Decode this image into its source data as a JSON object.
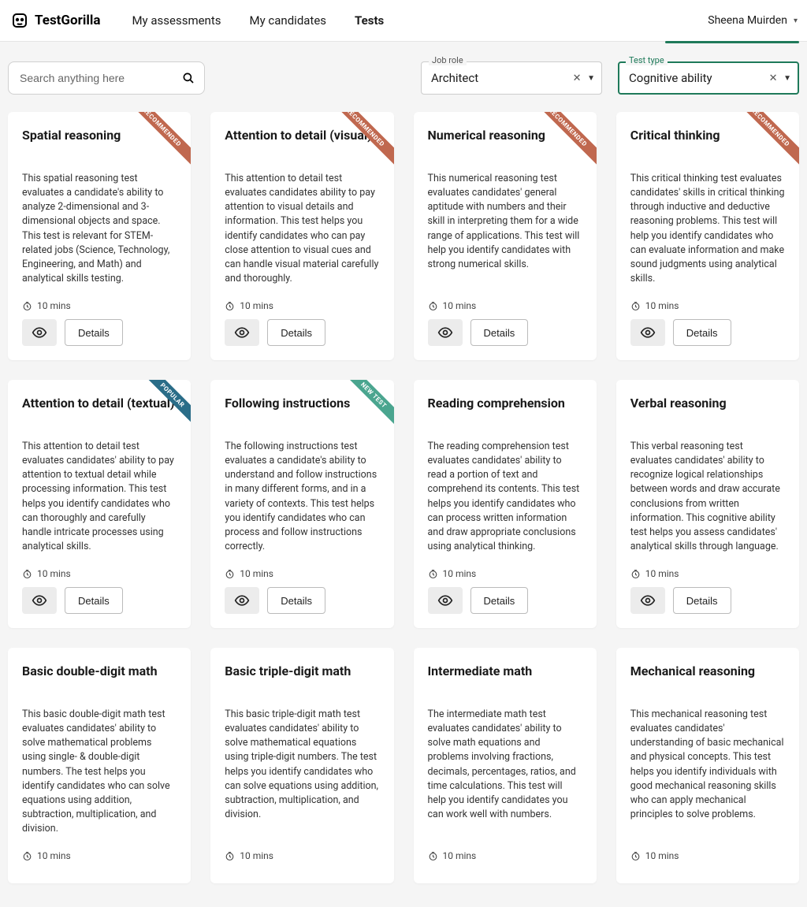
{
  "brand": "TestGorilla",
  "nav": {
    "assessments": "My assessments",
    "candidates": "My candidates",
    "tests": "Tests"
  },
  "user": {
    "name": "Sheena Muirden"
  },
  "search": {
    "placeholder": "Search anything here"
  },
  "filters": {
    "jobrole": {
      "label": "Job role",
      "value": "Architect"
    },
    "testtype": {
      "label": "Test type",
      "value": "Cognitive ability"
    }
  },
  "ribbons": {
    "recommended": "RECOMMENDED",
    "popular": "POPULAR",
    "newtest": "NEW TEST"
  },
  "labels": {
    "details": "Details",
    "duration": "10 mins"
  },
  "cards": [
    {
      "title": "Spatial reasoning",
      "desc": "This spatial reasoning test evaluates a candidate's ability to analyze 2-dimensional and 3-dimensional objects and space. This test is relevant for STEM-related jobs (Science, Technology, Engineering, and Math) and analytical skills testing.",
      "ribbon": "recommended"
    },
    {
      "title": "Attention to detail (visual)",
      "desc": "This attention to detail test evaluates candidates ability to pay attention to visual details and information. This test helps you identify candidates who can pay close attention to visual cues and can handle visual material carefully and thoroughly.",
      "ribbon": "recommended"
    },
    {
      "title": "Numerical reasoning",
      "desc": "This numerical reasoning test evaluates candidates' general aptitude with numbers and their skill in interpreting them for a wide range of applications. This test will help you identify candidates with strong numerical skills.",
      "ribbon": "recommended"
    },
    {
      "title": "Critical thinking",
      "desc": "This critical thinking test evaluates candidates' skills in critical thinking through inductive and deductive reasoning problems. This test will help you identify candidates who can evaluate information and make sound judgments using analytical skills.",
      "ribbon": "recommended"
    },
    {
      "title": "Attention to detail (textual)",
      "desc": "This attention to detail test evaluates candidates' ability to pay attention to textual detail while processing information. This test helps you identify candidates who can thoroughly and carefully handle intricate processes using analytical skills.",
      "ribbon": "popular"
    },
    {
      "title": "Following instructions",
      "desc": "The following instructions test evaluates a candidate's ability to understand and follow instructions in many different forms, and in a variety of contexts. This test helps you identify candidates who can process and follow instructions correctly.",
      "ribbon": "newtest"
    },
    {
      "title": "Reading comprehension",
      "desc": "The reading comprehension test evaluates candidates' ability to read a portion of text and comprehend its contents. This test helps you identify candidates who can process written information and draw appropriate conclusions using analytical thinking.",
      "ribbon": null
    },
    {
      "title": "Verbal reasoning",
      "desc": "This verbal reasoning test evaluates candidates' ability to recognize logical relationships between words and draw accurate conclusions from written information. This cognitive ability test helps you assess candidates' analytical skills through language.",
      "ribbon": null
    },
    {
      "title": "Basic double-digit math",
      "desc": "This basic double-digit math test evaluates candidates' ability to solve mathematical problems using single- & double-digit numbers. The test helps you identify candidates who can solve equations using addition, subtraction, multiplication, and division.",
      "ribbon": null
    },
    {
      "title": "Basic triple-digit math",
      "desc": "This basic triple-digit math test evaluates candidates' ability to solve mathematical equations using triple-digit numbers. The test helps you identify candidates who can solve equations using addition, subtraction, multiplication, and division.",
      "ribbon": null
    },
    {
      "title": "Intermediate math",
      "desc": "The intermediate math test evaluates candidates' ability to solve math equations and problems involving fractions, decimals, percentages, ratios, and time calculations. This test will help you identify candidates you can work well with numbers.",
      "ribbon": null
    },
    {
      "title": "Mechanical reasoning",
      "desc": "This mechanical reasoning test evaluates candidates' understanding of basic mechanical and physical concepts. This test helps you identify individuals with good mechanical reasoning skills who can apply mechanical principles to solve problems.",
      "ribbon": null
    }
  ]
}
